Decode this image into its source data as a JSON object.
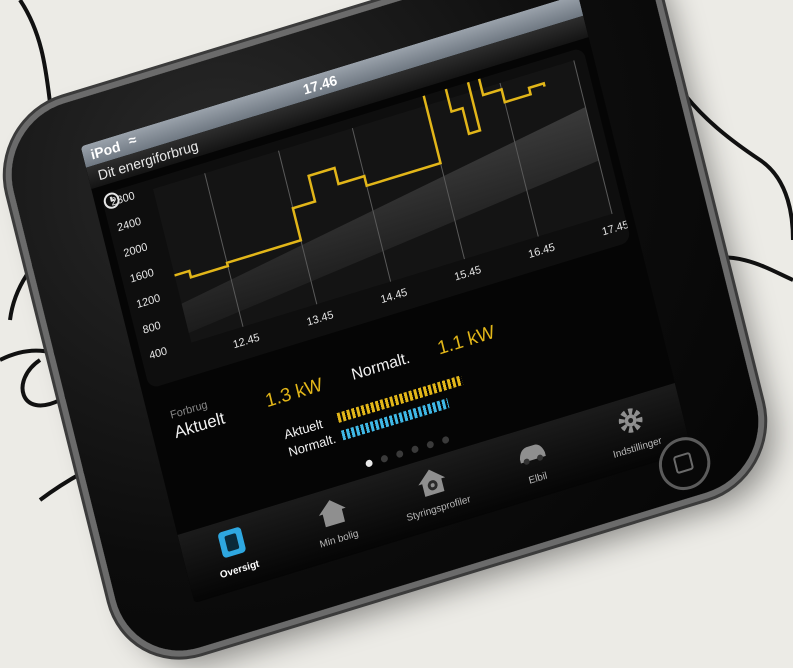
{
  "status_bar": {
    "carrier": "iPod",
    "wifi_icon": "wifi-icon",
    "time": "17.46"
  },
  "header": {
    "title": "Dit energiforbrug"
  },
  "chart_data": {
    "type": "line",
    "title": "",
    "xlabel": "",
    "ylabel": "",
    "y_tick_labels": [
      "400",
      "800",
      "1200",
      "1600",
      "2000",
      "2400",
      "2800"
    ],
    "x_tick_labels": [
      "12.45",
      "13.45",
      "14.45",
      "15.45",
      "16.45",
      "17.45"
    ],
    "ylim": [
      400,
      2800
    ],
    "x": [
      11.75,
      11.95,
      12.45,
      13.45,
      13.75,
      14.1,
      14.45,
      15.1,
      15.45,
      15.6,
      15.75,
      15.9,
      16.05,
      16.2,
      16.45,
      16.8,
      17.0
    ],
    "series": [
      {
        "values": [
          1450,
          1350,
          1400,
          1900,
          2300,
          2050,
          1900,
          1900,
          3100,
          3050,
          2600,
          2200,
          3000,
          2700,
          2500,
          2600,
          2550
        ],
        "color": "#e2b619"
      }
    ],
    "grid": true,
    "legend": "none"
  },
  "info": {
    "section_label": "Forbrug",
    "aktuelt_label": "Aktuelt",
    "aktuelt_value": "1.3 kW",
    "normalt_label": "Normalt.",
    "normalt_value": "1.1 kW",
    "bar_aktuelt_label": "Aktuelt",
    "bar_normalt_label": "Normalt.",
    "bar_aktuelt_fraction": 1.0,
    "bar_normalt_fraction": 0.85,
    "accent_color": "#e2b619",
    "secondary_color": "#3fb8e6"
  },
  "pager": {
    "total": 6,
    "active_index": 0
  },
  "tabs": [
    {
      "label": "Oversigt",
      "icon": "overview-icon",
      "active": true
    },
    {
      "label": "Min bolig",
      "icon": "house-icon",
      "active": false
    },
    {
      "label": "Styringsprofiler",
      "icon": "profile-house-icon",
      "active": false
    },
    {
      "label": "Elbil",
      "icon": "car-icon",
      "active": false
    },
    {
      "label": "Indstillinger",
      "icon": "gear-icon",
      "active": false
    }
  ]
}
